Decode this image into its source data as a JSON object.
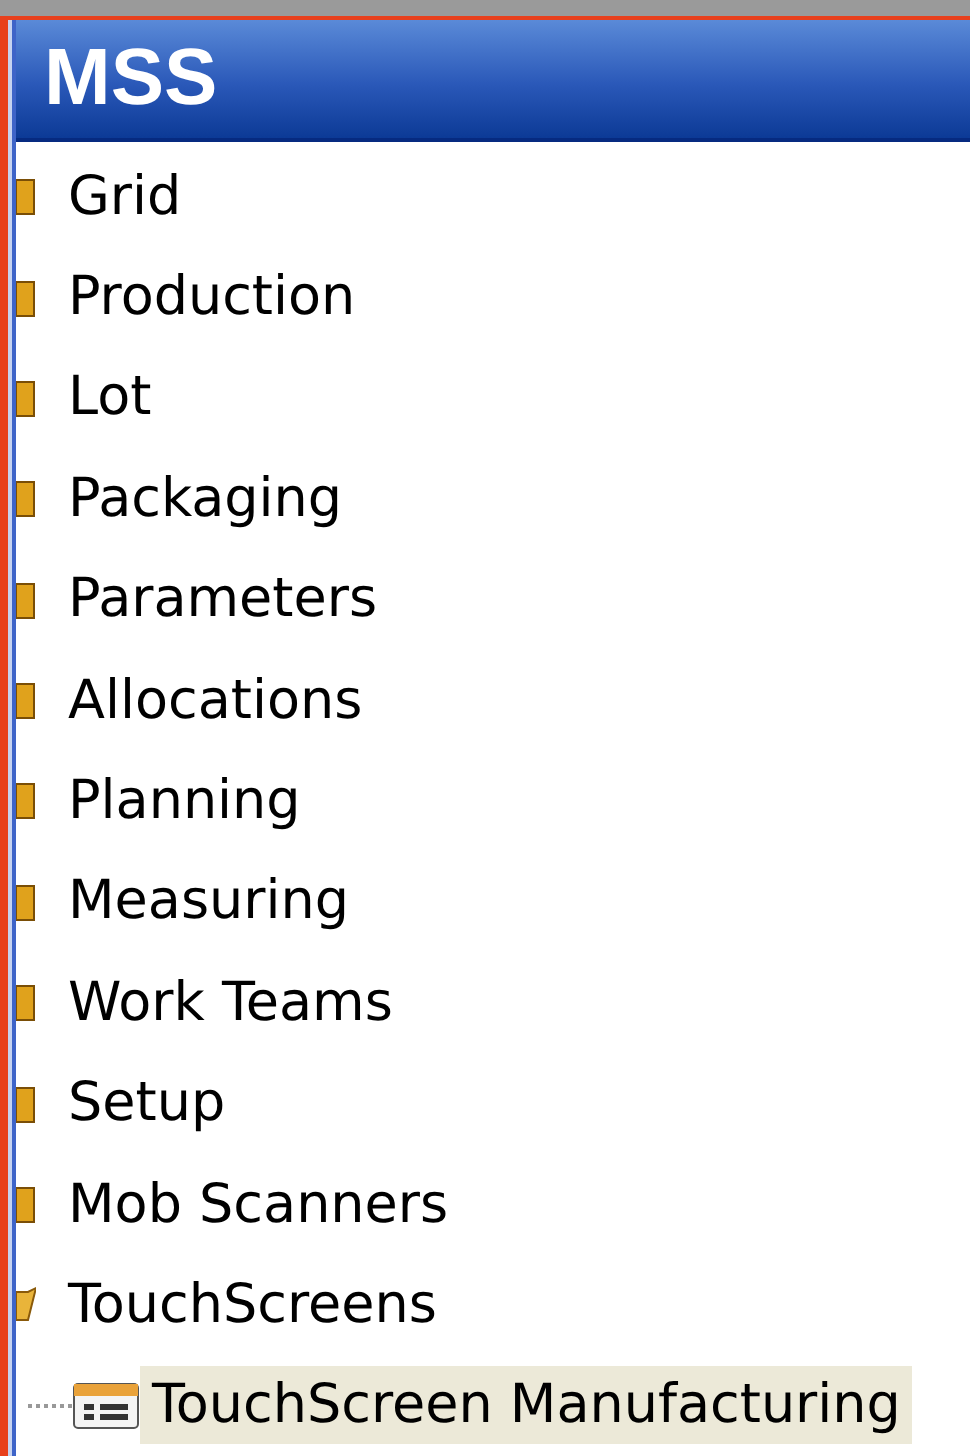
{
  "panel": {
    "title": "MSS"
  },
  "tree": [
    {
      "label": "Grid",
      "expanded": false
    },
    {
      "label": "Production",
      "expanded": false
    },
    {
      "label": "Lot",
      "expanded": false
    },
    {
      "label": "Packaging",
      "expanded": false
    },
    {
      "label": "Parameters",
      "expanded": false
    },
    {
      "label": "Allocations",
      "expanded": false
    },
    {
      "label": "Planning",
      "expanded": false
    },
    {
      "label": "Measuring",
      "expanded": false
    },
    {
      "label": "Work Teams",
      "expanded": false
    },
    {
      "label": "Setup",
      "expanded": false
    },
    {
      "label": "Mob Scanners",
      "expanded": false
    },
    {
      "label": "TouchScreens",
      "expanded": true,
      "children": [
        {
          "label": "TouchScreen Manufacturing",
          "selected": true
        }
      ]
    }
  ]
}
